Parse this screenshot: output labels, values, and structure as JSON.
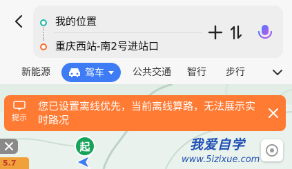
{
  "route": {
    "origin": "我的位置",
    "destination": "重庆西站-南2号进站口"
  },
  "tabs": [
    {
      "label": "新能源"
    },
    {
      "label": "驾车",
      "active": true
    },
    {
      "label": "公共交通"
    },
    {
      "label": "智行"
    },
    {
      "label": "步行"
    }
  ],
  "banner": {
    "badge": "提示",
    "message": "您已设置离线优先，当前离线算路，无法展示实时路况"
  },
  "map": {
    "start_label": "起",
    "poi_chip": "5.7",
    "watermark_cn": "我爱自学",
    "watermark_url": "www.5izixue.com"
  },
  "colors": {
    "accent": "#3d7cf5",
    "banner": "#ff7a33",
    "start_dot": "#18b7a8",
    "end_dot": "#ff6a2b",
    "start_marker": "#16a35a"
  },
  "icons": {
    "back": "chevron-left-icon",
    "add": "plus-icon",
    "swap": "swap-icon",
    "voice": "microphone-icon",
    "car": "car-icon",
    "more": "chevron-down-icon",
    "close": "close-icon",
    "locate": "locate-icon"
  }
}
